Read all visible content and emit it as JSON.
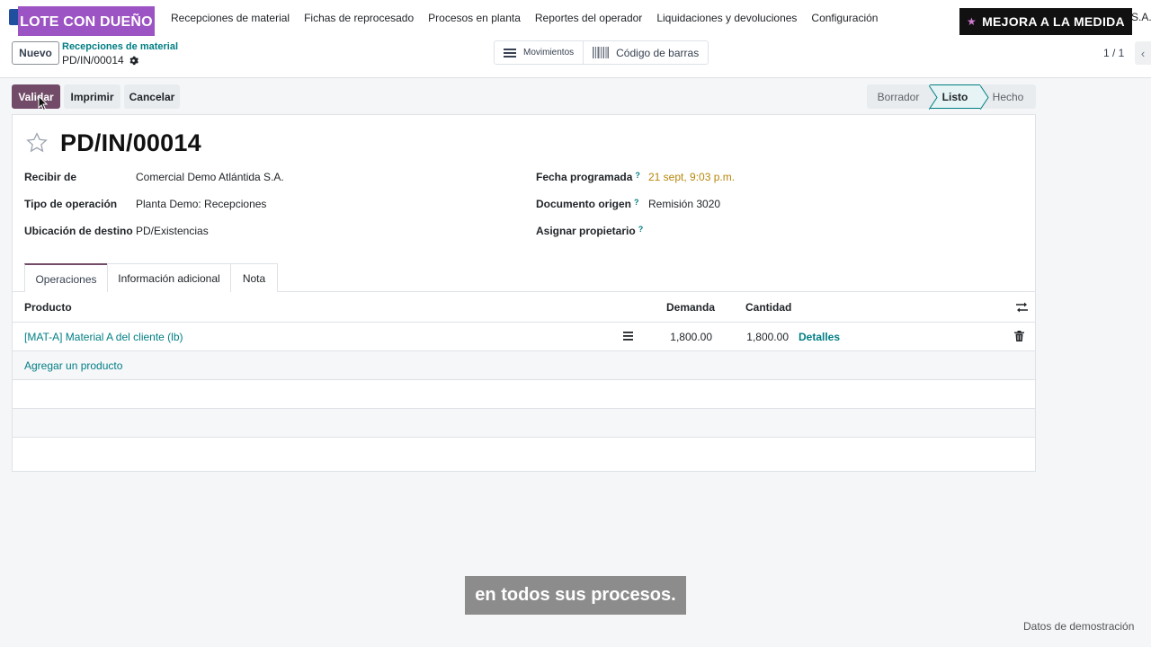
{
  "overlay": {
    "badge_left": "LOTE CON DUEÑO",
    "badge_right": "MEJORA A LA MEDIDA",
    "badge_right_icon": "star-icon",
    "subtitle": "en todos sus procesos.",
    "watermark": "Datos de demostración"
  },
  "nav": {
    "company_fragment": "S.A.",
    "menu": [
      "Recepciones de material",
      "Fichas de reprocesado",
      "Procesos en planta",
      "Reportes del operador",
      "Liquidaciones y devoluciones",
      "Configuración"
    ]
  },
  "control_panel": {
    "new_label": "Nuevo",
    "breadcrumb_parent": "Recepciones de material",
    "breadcrumb_current": "PD/IN/00014",
    "moves_label": "Movimientos",
    "barcode_label": "Código de barras",
    "pager": "1 / 1"
  },
  "actions": {
    "validate": "Validar",
    "print": "Imprimir",
    "cancel": "Cancelar"
  },
  "status": {
    "stages": [
      "Borrador",
      "Listo",
      "Hecho"
    ],
    "current": "Listo"
  },
  "record": {
    "name": "PD/IN/00014",
    "fields_left": [
      {
        "label": "Recibir de",
        "value": "Comercial Demo Atlántida S.A."
      },
      {
        "label": "Tipo de operación",
        "value": "Planta Demo: Recepciones"
      },
      {
        "label": "Ubicación de destino",
        "value": "PD/Existencias"
      }
    ],
    "fields_right": [
      {
        "label": "Fecha programada",
        "value": "21 sept, 9:03 p.m."
      },
      {
        "label": "Documento origen",
        "value": "Remisión 3020"
      },
      {
        "label": "Asignar propietario",
        "value": ""
      }
    ],
    "help_mark": "?"
  },
  "tabs": [
    "Operaciones",
    "Información adicional",
    "Nota"
  ],
  "table": {
    "headers": {
      "product": "Producto",
      "demand": "Demanda",
      "quantity": "Cantidad"
    },
    "rows": [
      {
        "product": "[MAT-A] Material A del cliente (lb)",
        "demand": "1,800.00",
        "quantity": "1,800.00",
        "details": "Detalles"
      }
    ],
    "add_line": "Agregar un producto"
  },
  "colors": {
    "primary": "#714b67",
    "link": "#017e84",
    "badge_left_bg": "#9c53c3",
    "date": "#b8860b"
  }
}
